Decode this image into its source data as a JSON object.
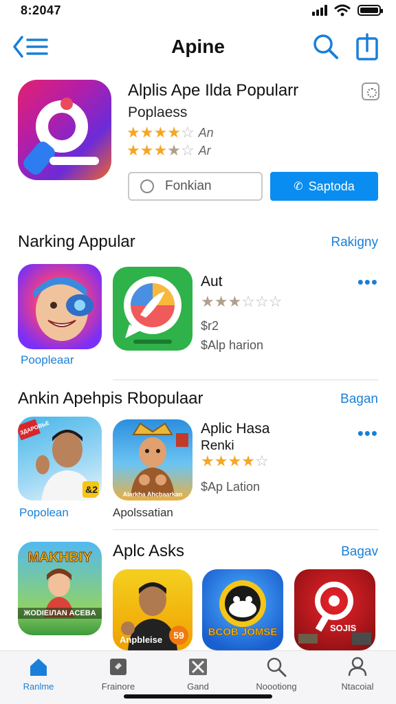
{
  "status_bar": {
    "time": "8:2047"
  },
  "header": {
    "title": "Apine"
  },
  "featured": {
    "title": "Alplis Ape Ilda Popularr",
    "subtitle": "Poplaess",
    "rating1": {
      "stars": 4,
      "label": "An"
    },
    "rating2": {
      "stars": 3.5,
      "label": "Ar"
    },
    "secondary_button": "Fonkian",
    "primary_button": "Saptoda"
  },
  "section1": {
    "title": "Narking Appular",
    "link": "Rakigny",
    "tile1_caption": "Poopleaar",
    "app": {
      "name": "Aut",
      "stars": 2.5,
      "price": "$r2",
      "meta": "$Alp harion"
    }
  },
  "section2": {
    "title": "Ankin Apehpis Rbopulaar",
    "link": "Bagan",
    "tile1_caption": "Popolean",
    "tile2_caption": "Apolssatian",
    "tile1_badge": "ЗДАРОВЬЕ",
    "tile1_corner": "&2",
    "tile2_text": "Alarkha Ahcbaarkan",
    "app": {
      "name": "Aplic Hasa",
      "name2": "Renki",
      "stars": 4,
      "meta": "$Ap Lation"
    }
  },
  "section3": {
    "title": "Aplc Asks",
    "link": "Bagav",
    "tile1_text_top": "MAKHBIY",
    "tile1_text_bottom": "ЖODIEIЛAN ACEBA",
    "tile2_text": "Anpbleise",
    "tile2_badge": "59",
    "tile3_text": "BCOB JOMSE",
    "tile4_text": "SOJIS"
  },
  "tab_bar": {
    "tabs": [
      {
        "label": "Ranlme",
        "icon": "home-icon"
      },
      {
        "label": "Frainore",
        "icon": "featured-icon"
      },
      {
        "label": "Gand",
        "icon": "games-icon"
      },
      {
        "label": "Noootiong",
        "icon": "search-icon"
      },
      {
        "label": "Ntacoial",
        "icon": "person-icon"
      }
    ]
  },
  "colors": {
    "accent": "#0a8df0",
    "link": "#1a7fd8",
    "star": "#f5a623"
  }
}
